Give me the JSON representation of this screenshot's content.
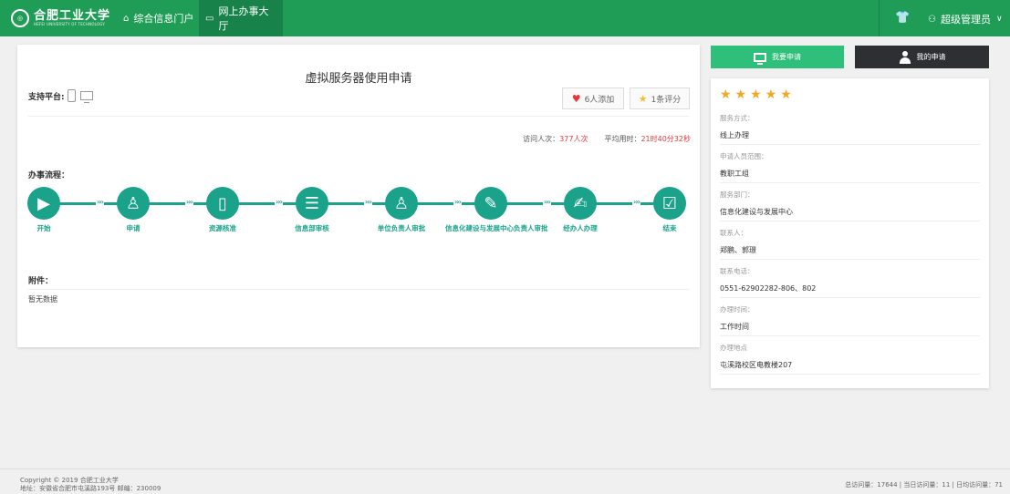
{
  "header": {
    "logo_text": "合肥工业大学",
    "logo_sub": "HEFEI UNIVERSITY OF TECHNOLOGY",
    "nav": [
      {
        "label": "综合信息门户",
        "icon": "home-icon"
      },
      {
        "label": "网上办事大厅",
        "icon": "monitor-icon"
      }
    ],
    "user": "超级管理员"
  },
  "main": {
    "title": "虚拟服务器使用申请",
    "platform_label": "支持平台:",
    "add_button": "6人添加",
    "rate_button": "1条评分",
    "visits_label": "访问人次：",
    "visits_value": "377人次",
    "avg_label": "平均用时：",
    "avg_value": "21时40分32秒",
    "flow_label": "办事流程：",
    "steps": [
      {
        "label": "开始",
        "icon": "play-icon"
      },
      {
        "label": "申请",
        "icon": "user-icon"
      },
      {
        "label": "资源核准",
        "icon": "device-icon"
      },
      {
        "label": "信息部审核",
        "icon": "document-icon"
      },
      {
        "label": "单位负责人审批",
        "icon": "person-icon"
      },
      {
        "label": "信息化建设与发展中心负责人审批",
        "icon": "person-edit-icon"
      },
      {
        "label": "经办人办理",
        "icon": "edit-icon"
      },
      {
        "label": "结束",
        "icon": "check-icon"
      }
    ],
    "attach_label": "附件：",
    "no_data": "暂无数据"
  },
  "side": {
    "apply_button": "我要申请",
    "mine_button": "我的申请",
    "rating_stars": 5,
    "fields": [
      {
        "key": "服务方式：",
        "value": "线上办理"
      },
      {
        "key": "申请人员范围：",
        "value": "教职工组"
      },
      {
        "key": "服务部门：",
        "value": "信息化建设与发展中心"
      },
      {
        "key": "联系人：",
        "value": "郑鹏、郭璟"
      },
      {
        "key": "联系电话：",
        "value": "0551-62902282-806、802"
      },
      {
        "key": "办理时间：",
        "value": "工作时间"
      },
      {
        "key": "办理地点",
        "value": "屯溪路校区电教楼207"
      }
    ]
  },
  "footer": {
    "copyright": "Copyright © 2019 合肥工业大学",
    "address": "地址：安徽省合肥市屯溪路193号 邮编：230009",
    "visits": "总访问量：17644 | 当日访问量：11 | 日均访问量：71"
  },
  "colors": {
    "brand": "#1f9d57",
    "flow": "#1aa28a",
    "star": "#f5a623"
  }
}
